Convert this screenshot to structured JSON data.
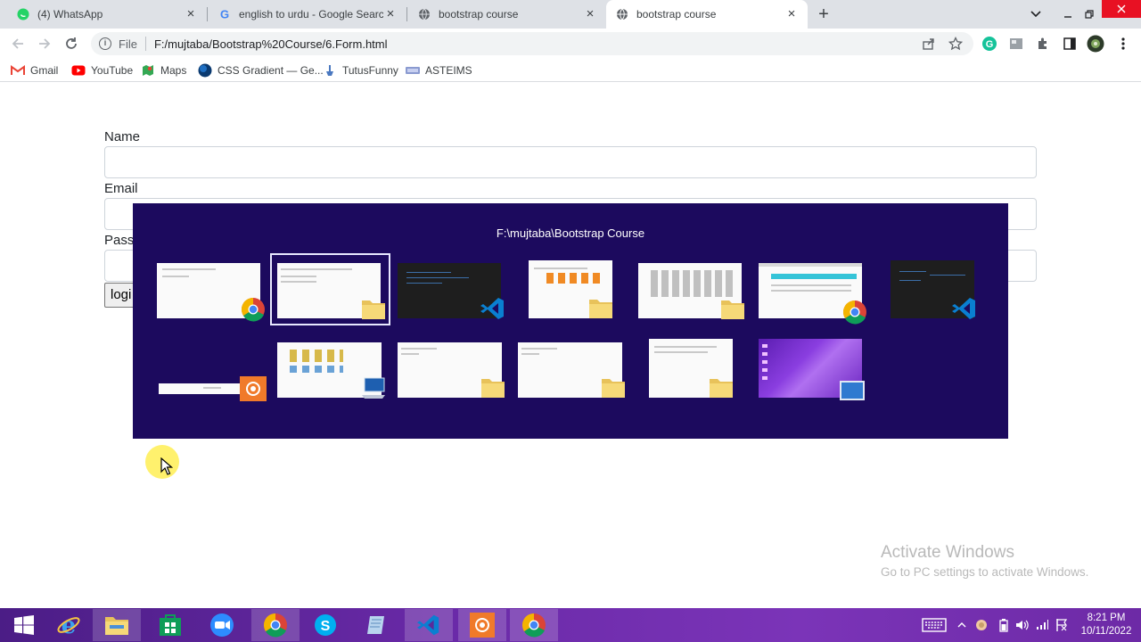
{
  "browser": {
    "tabs": [
      {
        "title": "(4) WhatsApp",
        "icon": "whatsapp-icon",
        "active": false
      },
      {
        "title": "english to urdu - Google Search",
        "icon": "google-icon",
        "active": false
      },
      {
        "title": "bootstrap course",
        "icon": "globe-icon",
        "active": false
      },
      {
        "title": "bootstrap course",
        "icon": "globe-icon",
        "active": true
      }
    ],
    "omnibox": {
      "scheme": "File",
      "url": "F:/mujtaba/Bootstrap%20Course/6.Form.html"
    },
    "bookmarks": [
      {
        "label": "Gmail",
        "icon": "gmail-icon"
      },
      {
        "label": "YouTube",
        "icon": "youtube-icon"
      },
      {
        "label": "Maps",
        "icon": "maps-icon"
      },
      {
        "label": "CSS Gradient — Ge...",
        "icon": "gradient-icon"
      },
      {
        "label": "TutusFunny",
        "icon": "tutusfunny-icon"
      },
      {
        "label": "ASTEIMS",
        "icon": "asteims-icon"
      }
    ]
  },
  "form": {
    "name_label": "Name",
    "email_label": "Email",
    "password_label": "Pass",
    "login_label": "logi"
  },
  "switcher": {
    "title": "F:\\mujtaba\\Bootstrap Course",
    "windows": [
      {
        "app": "chrome",
        "row": 1,
        "selected": false
      },
      {
        "app": "file-explorer",
        "row": 1,
        "selected": true
      },
      {
        "app": "vscode",
        "row": 1,
        "selected": false
      },
      {
        "app": "file-explorer",
        "row": 1,
        "selected": false
      },
      {
        "app": "file-explorer",
        "row": 1,
        "selected": false
      },
      {
        "app": "chrome",
        "row": 1,
        "selected": false
      },
      {
        "app": "vscode",
        "row": 1,
        "selected": false
      },
      {
        "app": "recorder",
        "row": 2,
        "selected": false
      },
      {
        "app": "this-pc",
        "row": 2,
        "selected": false
      },
      {
        "app": "file-explorer",
        "row": 2,
        "selected": false
      },
      {
        "app": "file-explorer",
        "row": 2,
        "selected": false
      },
      {
        "app": "file-explorer",
        "row": 2,
        "selected": false
      },
      {
        "app": "desktop",
        "row": 2,
        "selected": false
      }
    ]
  },
  "watermark": {
    "line1": "Activate Windows",
    "line2": "Go to PC settings to activate Windows."
  },
  "taskbar": {
    "apps": [
      "start-icon",
      "internet-explorer-icon",
      "file-explorer-icon",
      "store-icon",
      "zoom-icon",
      "chrome-icon",
      "skype-icon",
      "notepad-icon",
      "vscode-icon",
      "recorder-icon",
      "chrome-profile-icon"
    ],
    "clock": {
      "time": "8:21 PM",
      "date": "10/11/2022"
    }
  },
  "colors": {
    "switcher_bg": "#1c0a5e",
    "taskbar": "#6a2aa8",
    "tabstrip": "#dee1e6"
  }
}
